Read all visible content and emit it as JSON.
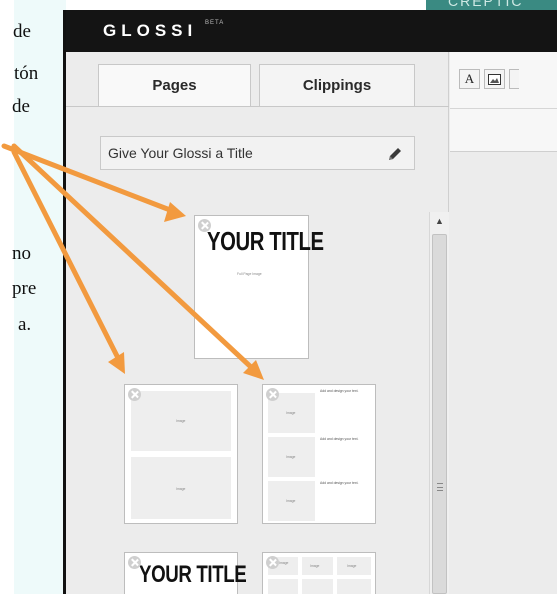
{
  "document": {
    "lines": [
      "de",
      "tón",
      "de",
      "no",
      "pre",
      "a."
    ]
  },
  "watermark": {
    "text": "CREPTIC"
  },
  "app": {
    "logo": "GLOSSI",
    "beta": "BETA"
  },
  "tabs": [
    {
      "label": "Pages",
      "active": true
    },
    {
      "label": "Clippings",
      "active": false
    }
  ],
  "title_field": {
    "value": "Give Your Glossi a Title",
    "icon": "pencil-icon"
  },
  "toolbar": {
    "tools": [
      {
        "label": "A",
        "icon": "text-tool-icon"
      },
      {
        "label": "",
        "icon": "image-tool-icon"
      },
      {
        "label": "",
        "icon": "more-tool-icon"
      }
    ]
  },
  "templates": {
    "cover": {
      "title": "YOUR TITLE",
      "caption": "Full Page Image"
    },
    "two_images": {
      "labels": [
        "Image",
        "Image"
      ]
    },
    "image_text": {
      "rows": [
        {
          "image": "Image",
          "text": "Add and design your text."
        },
        {
          "image": "Image",
          "text": "Add and design your text."
        },
        {
          "image": "Image",
          "text": "Add and design your text."
        }
      ]
    },
    "cover_small": {
      "title": "YOUR TITLE"
    },
    "grid": {
      "labels": [
        "Image",
        "Image",
        "Image"
      ]
    }
  },
  "colors": {
    "topbar": "#141414",
    "arrow": "#f29a3f",
    "doc_band": "#eefafa",
    "watermark": "#3a8a82"
  }
}
